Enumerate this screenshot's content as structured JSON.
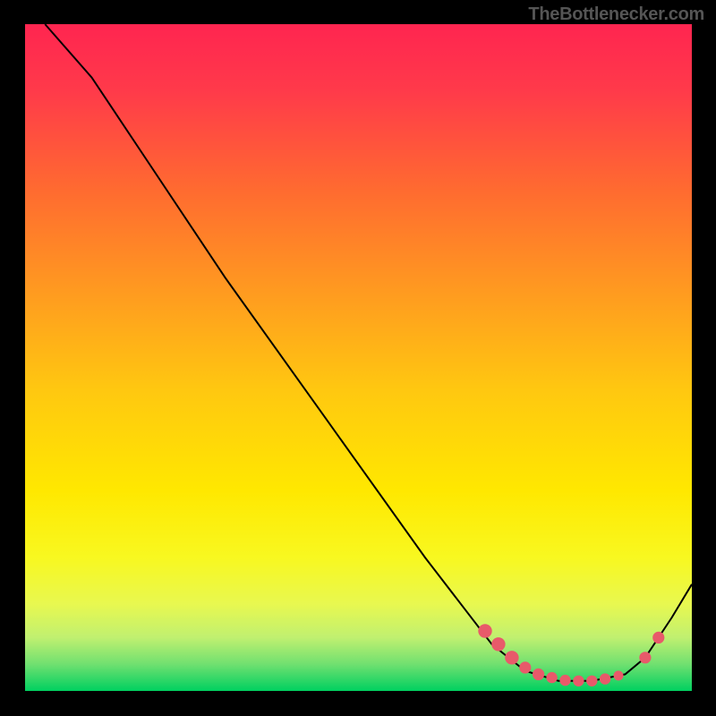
{
  "watermark": "TheBottlenecker.com",
  "chart_data": {
    "type": "line",
    "title": "",
    "xlabel": "",
    "ylabel": "",
    "xlim": [
      0,
      100
    ],
    "ylim": [
      0,
      100
    ],
    "gradient_top": "#FF2550",
    "gradient_mid": "#FFC800",
    "gradient_bottom": "#00D060",
    "curve": [
      {
        "x": 3,
        "y": 100
      },
      {
        "x": 10,
        "y": 92
      },
      {
        "x": 18,
        "y": 80
      },
      {
        "x": 30,
        "y": 62
      },
      {
        "x": 45,
        "y": 41
      },
      {
        "x": 60,
        "y": 20
      },
      {
        "x": 70,
        "y": 7
      },
      {
        "x": 75,
        "y": 3
      },
      {
        "x": 80,
        "y": 1.5
      },
      {
        "x": 85,
        "y": 1.5
      },
      {
        "x": 90,
        "y": 2.5
      },
      {
        "x": 93,
        "y": 5
      },
      {
        "x": 97,
        "y": 11
      },
      {
        "x": 100,
        "y": 16
      }
    ],
    "markers": [
      {
        "x": 69,
        "y": 9,
        "r": 3.5
      },
      {
        "x": 71,
        "y": 7,
        "r": 3.5
      },
      {
        "x": 73,
        "y": 5,
        "r": 3.5
      },
      {
        "x": 75,
        "y": 3.5,
        "r": 3.0
      },
      {
        "x": 77,
        "y": 2.5,
        "r": 3.0
      },
      {
        "x": 79,
        "y": 2,
        "r": 2.8
      },
      {
        "x": 81,
        "y": 1.6,
        "r": 2.8
      },
      {
        "x": 83,
        "y": 1.5,
        "r": 2.8
      },
      {
        "x": 85,
        "y": 1.5,
        "r": 2.8
      },
      {
        "x": 87,
        "y": 1.8,
        "r": 2.8
      },
      {
        "x": 89,
        "y": 2.3,
        "r": 2.5
      },
      {
        "x": 93,
        "y": 5,
        "r": 3.0
      },
      {
        "x": 95,
        "y": 8,
        "r": 3.0
      }
    ],
    "marker_color": "#E85A6A",
    "curve_color": "#000000"
  }
}
